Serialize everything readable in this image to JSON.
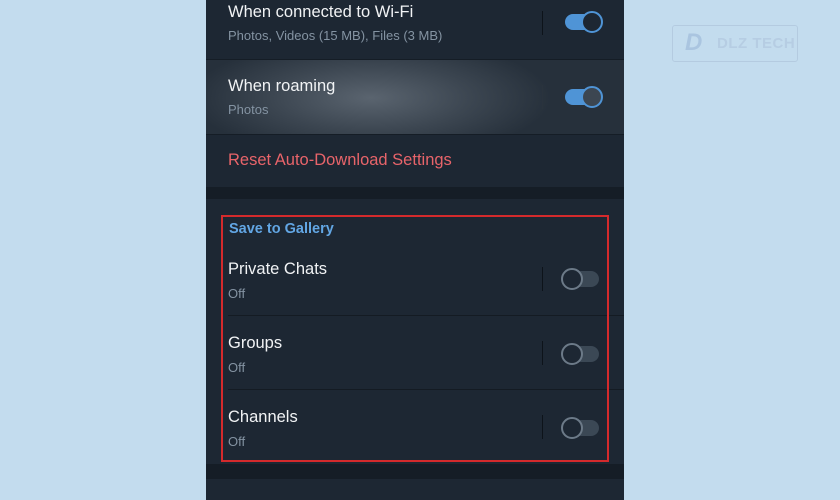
{
  "watermark": {
    "mark": "D",
    "brand": "DLZ TECH"
  },
  "auto_download": {
    "wifi": {
      "title": "When connected to Wi-Fi",
      "subtitle": "Photos, Videos (15 MB), Files (3 MB)",
      "enabled": true
    },
    "roaming": {
      "title": "When roaming",
      "subtitle": "Photos",
      "enabled": true
    },
    "reset_label": "Reset Auto-Download Settings"
  },
  "save_to_gallery": {
    "header": "Save to Gallery",
    "items": [
      {
        "title": "Private Chats",
        "status": "Off",
        "enabled": false
      },
      {
        "title": "Groups",
        "status": "Off",
        "enabled": false
      },
      {
        "title": "Channels",
        "status": "Off",
        "enabled": false
      }
    ]
  },
  "colors": {
    "page_background": "#c3dcee",
    "panel_background": "#1d2733",
    "accent": "#4f94d6",
    "destructive": "#e8646a",
    "highlight_border": "#d42a2c"
  },
  "icons": {
    "toggle_on": "toggle-switch-on-icon",
    "toggle_off": "toggle-switch-off-icon"
  }
}
